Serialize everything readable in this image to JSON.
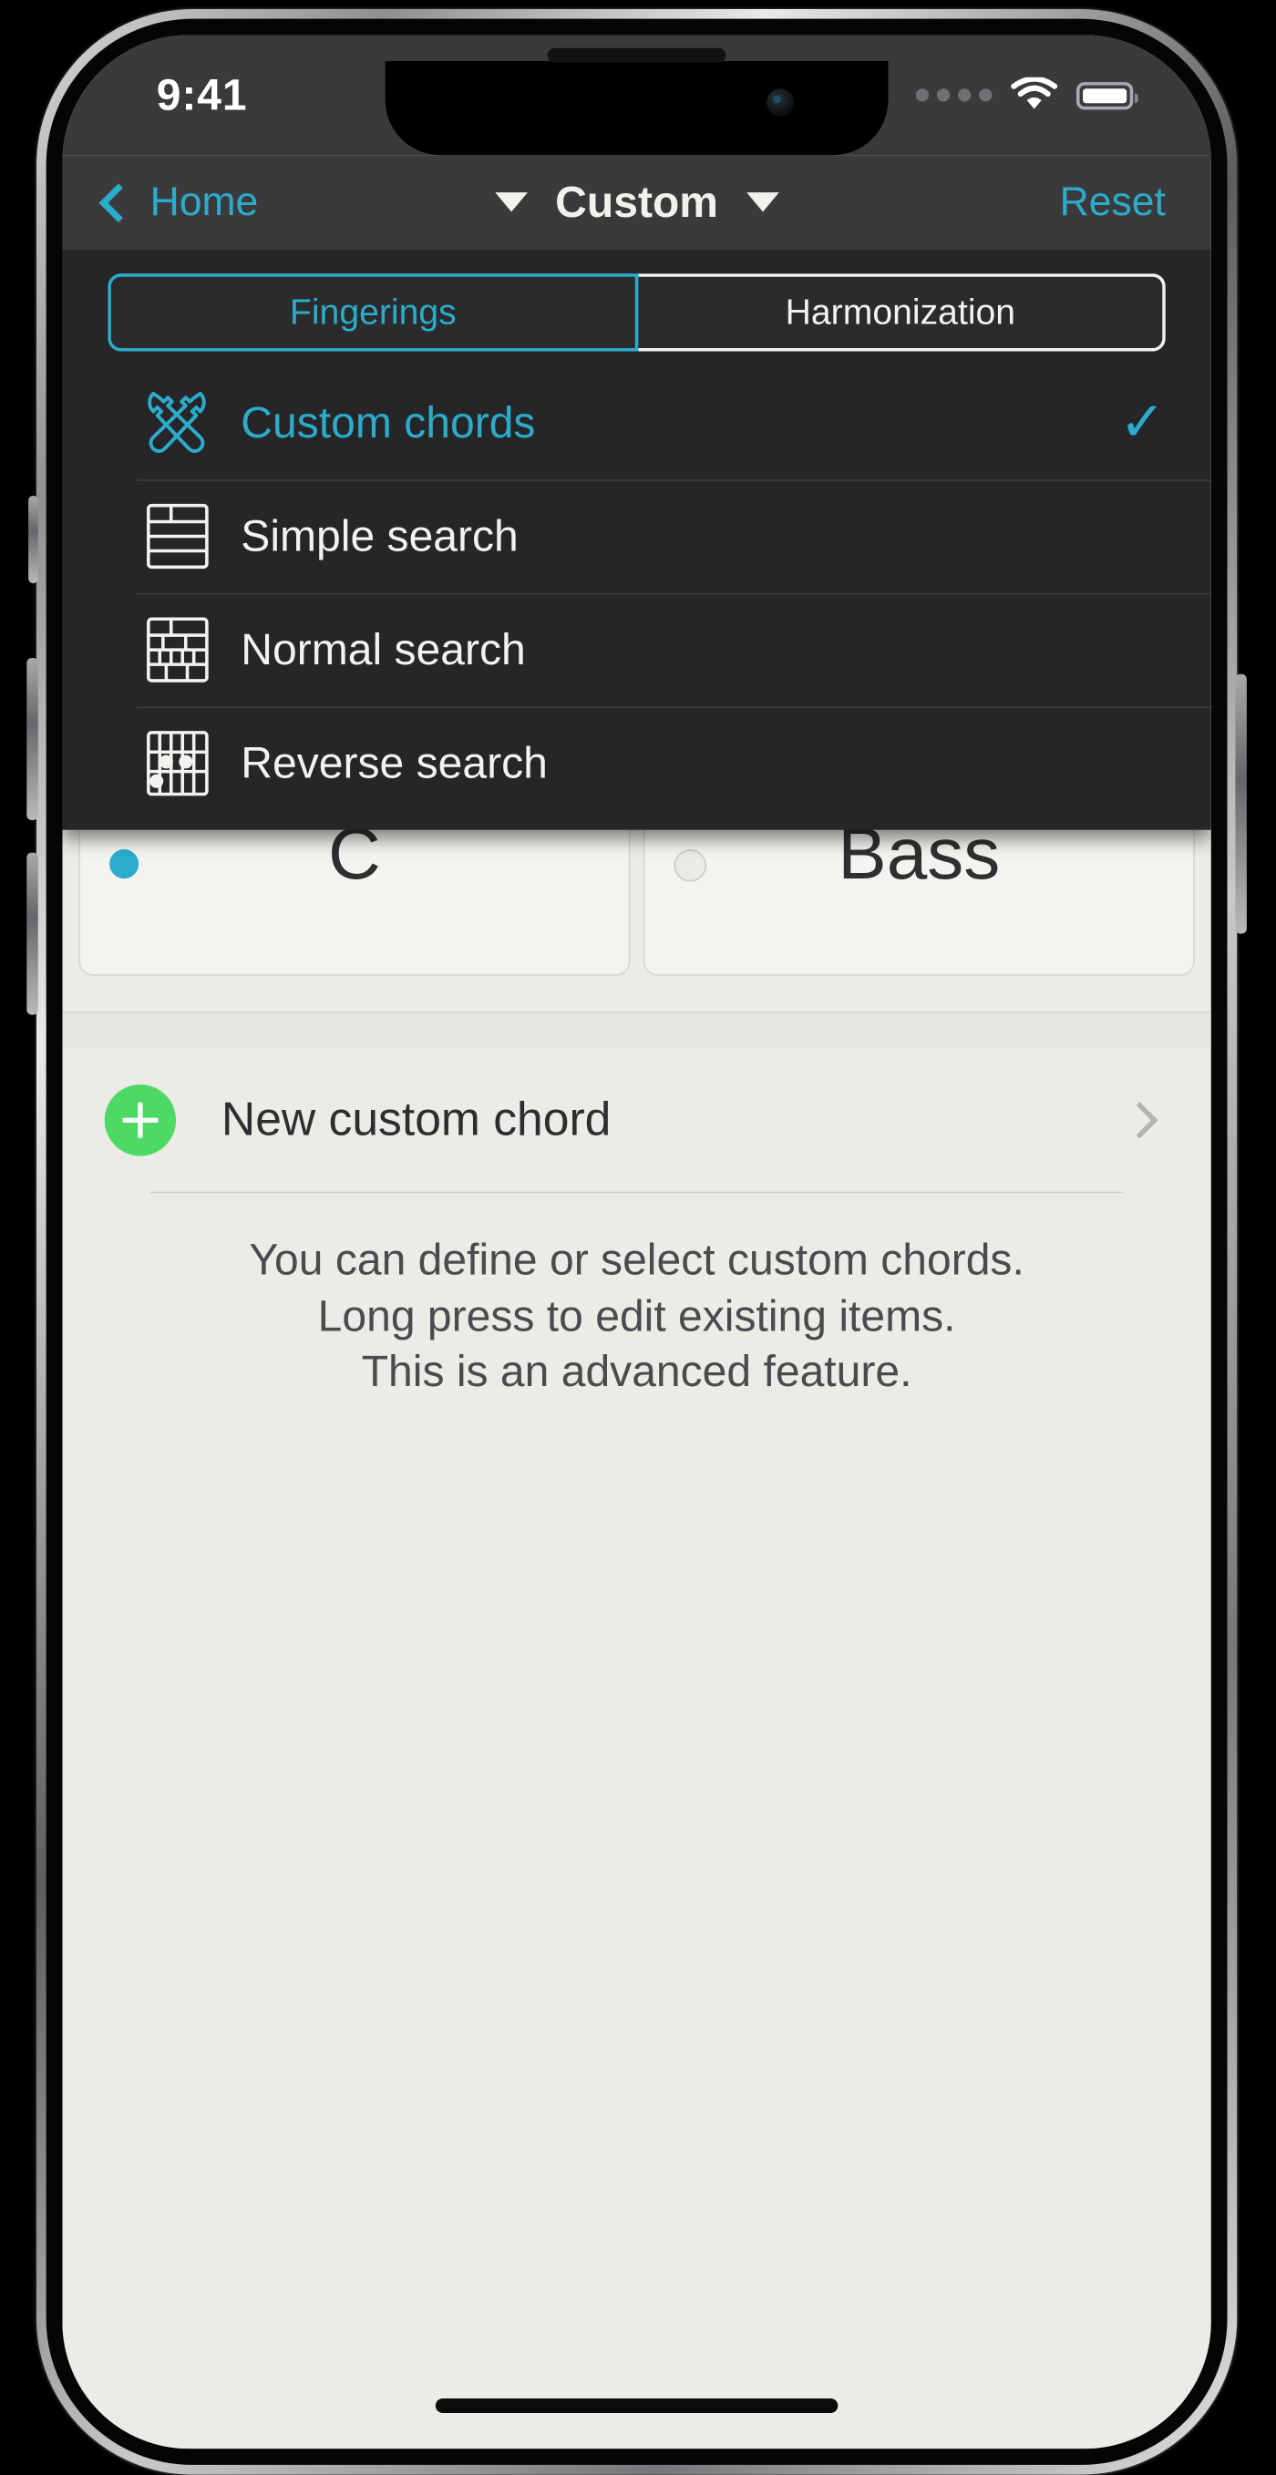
{
  "status_bar": {
    "time": "9:41",
    "cellular_icon": "cellular-dots-icon",
    "wifi_icon": "wifi-icon",
    "battery_icon": "battery-full-icon"
  },
  "nav_bar": {
    "back_label": "Home",
    "back_icon": "chevron-left-icon",
    "title": "Custom",
    "left_caret_icon": "triangle-down-icon",
    "right_caret_icon": "triangle-down-icon",
    "reset_label": "Reset"
  },
  "dropdown": {
    "segmented": {
      "options": [
        {
          "label": "Fingerings",
          "active": true
        },
        {
          "label": "Harmonization",
          "active": false
        }
      ]
    },
    "menu_items": [
      {
        "label": "Custom chords",
        "icon": "tools-icon",
        "selected": true,
        "check_glyph": "✓"
      },
      {
        "label": "Simple search",
        "icon": "fretboard-simple-icon",
        "selected": false
      },
      {
        "label": "Normal search",
        "icon": "fretboard-normal-icon",
        "selected": false
      },
      {
        "label": "Reverse search",
        "icon": "chord-diagram-icon",
        "selected": false
      }
    ]
  },
  "main": {
    "cards": [
      {
        "title": "C",
        "selected": true
      },
      {
        "title": "Bass",
        "selected": false
      }
    ],
    "new_chord": {
      "label": "New custom chord",
      "add_icon": "plus-circle-icon",
      "disclosure_icon": "chevron-right-icon"
    },
    "hint_lines": [
      "You can define or select custom chords.",
      "Long press to edit existing items.",
      "This is an advanced feature."
    ]
  },
  "colors": {
    "accent": "#2BACCB",
    "nav_background": "#3A3A3C",
    "dropdown_background": "#262629",
    "content_background": "#ECEBE6",
    "add_green": "#4CD964"
  }
}
